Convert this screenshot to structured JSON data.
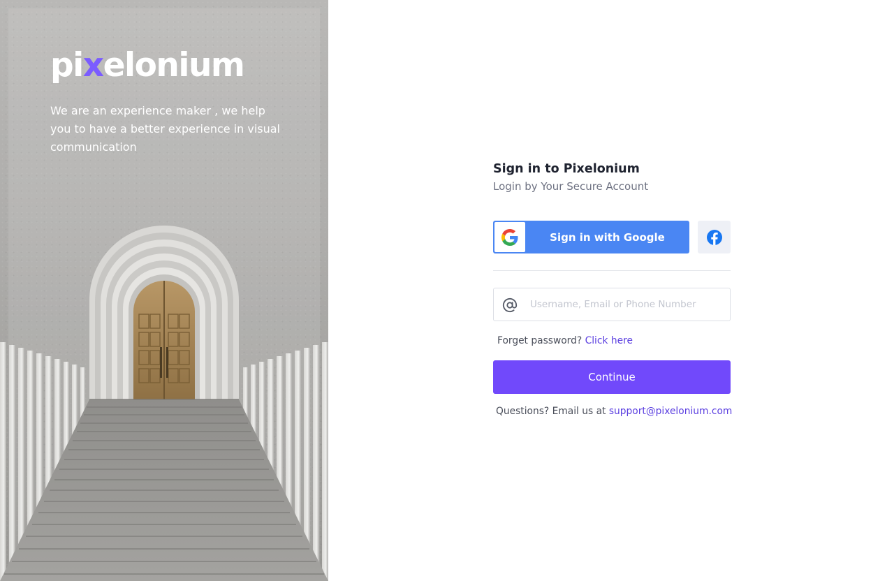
{
  "brand": {
    "logo_prefix": "pi",
    "logo_x": "x",
    "logo_suffix": "elonium",
    "tagline": "We are an experience maker , we help you to have a better experience in visual communication"
  },
  "signin": {
    "title": "Sign in to Pixelonium",
    "subtitle": "Login by Your Secure Account",
    "google_label": "Sign in with Google",
    "facebook_icon": "facebook-icon",
    "google_icon": "google-icon"
  },
  "username_field": {
    "placeholder": "Username, Email or Phone Number",
    "value": "",
    "icon": "at-sign-icon"
  },
  "forgot": {
    "text": "Forget password?",
    "link": "Click here"
  },
  "continue_label": "Continue",
  "support": {
    "text": "Questions? Email us at",
    "email": "support@pixelonium.com"
  },
  "colors": {
    "primary": "#7149fb",
    "google_blue": "#4a86f3",
    "link": "#5a3ee0",
    "logo_accent": "#7b5cff"
  }
}
